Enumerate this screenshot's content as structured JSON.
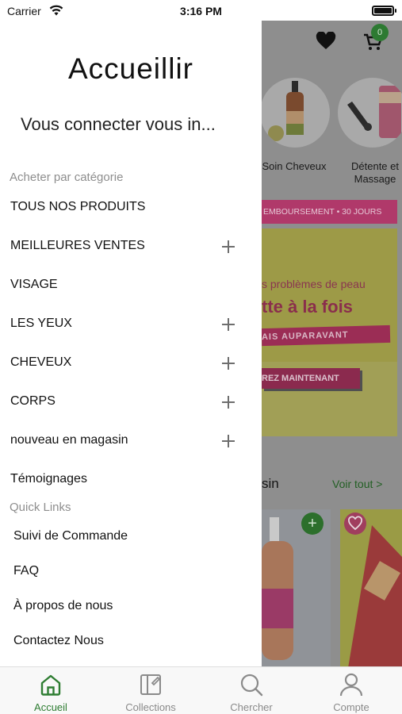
{
  "status_bar": {
    "carrier": "Carrier",
    "time": "3:16 PM"
  },
  "drawer": {
    "title": "Accueillir",
    "subtitle": "Vous connecter vous in...",
    "shop_by_category_label": "Acheter par catégorie",
    "menu_items": [
      {
        "label": "TOUS NOS PRODUITS",
        "expandable": false
      },
      {
        "label": "MEILLEURES VENTES",
        "expandable": true
      },
      {
        "label": "VISAGE",
        "expandable": false
      },
      {
        "label": "LES YEUX",
        "expandable": true
      },
      {
        "label": "CHEVEUX",
        "expandable": true
      },
      {
        "label": "CORPS",
        "expandable": true
      },
      {
        "label": "nouveau en magasin",
        "expandable": true
      },
      {
        "label": "Témoignages",
        "expandable": false
      }
    ],
    "quick_links_label": "Quick Links",
    "quick_links": [
      "Suivi de Commande",
      "FAQ",
      "À propos de nous",
      "Contactez Nous"
    ]
  },
  "background_app": {
    "cart_count": "0",
    "categories": [
      "Soin Cheveux",
      "Détente et Massage"
    ],
    "promo_strip": "EMBOURSEMENT • 30 JOURS",
    "banner": {
      "line1": "s problèmes de peau",
      "line2": "tte à la fois",
      "stripe": "AIS AUPARAVANT",
      "button": "REZ MAINTENANT"
    },
    "section_title": "sin",
    "see_all": "Voir tout >",
    "product_add_symbol": "+"
  },
  "tab_bar": {
    "tabs": [
      {
        "label": "Accueil",
        "icon": "home-icon",
        "active": true
      },
      {
        "label": "Collections",
        "icon": "collections-icon",
        "active": false
      },
      {
        "label": "Chercher",
        "icon": "search-icon",
        "active": false
      },
      {
        "label": "Compte",
        "icon": "account-icon",
        "active": false
      }
    ]
  },
  "colors": {
    "accent": "#2e7d32",
    "promo": "#e04c8a",
    "muted_text": "#8e8e8e"
  }
}
